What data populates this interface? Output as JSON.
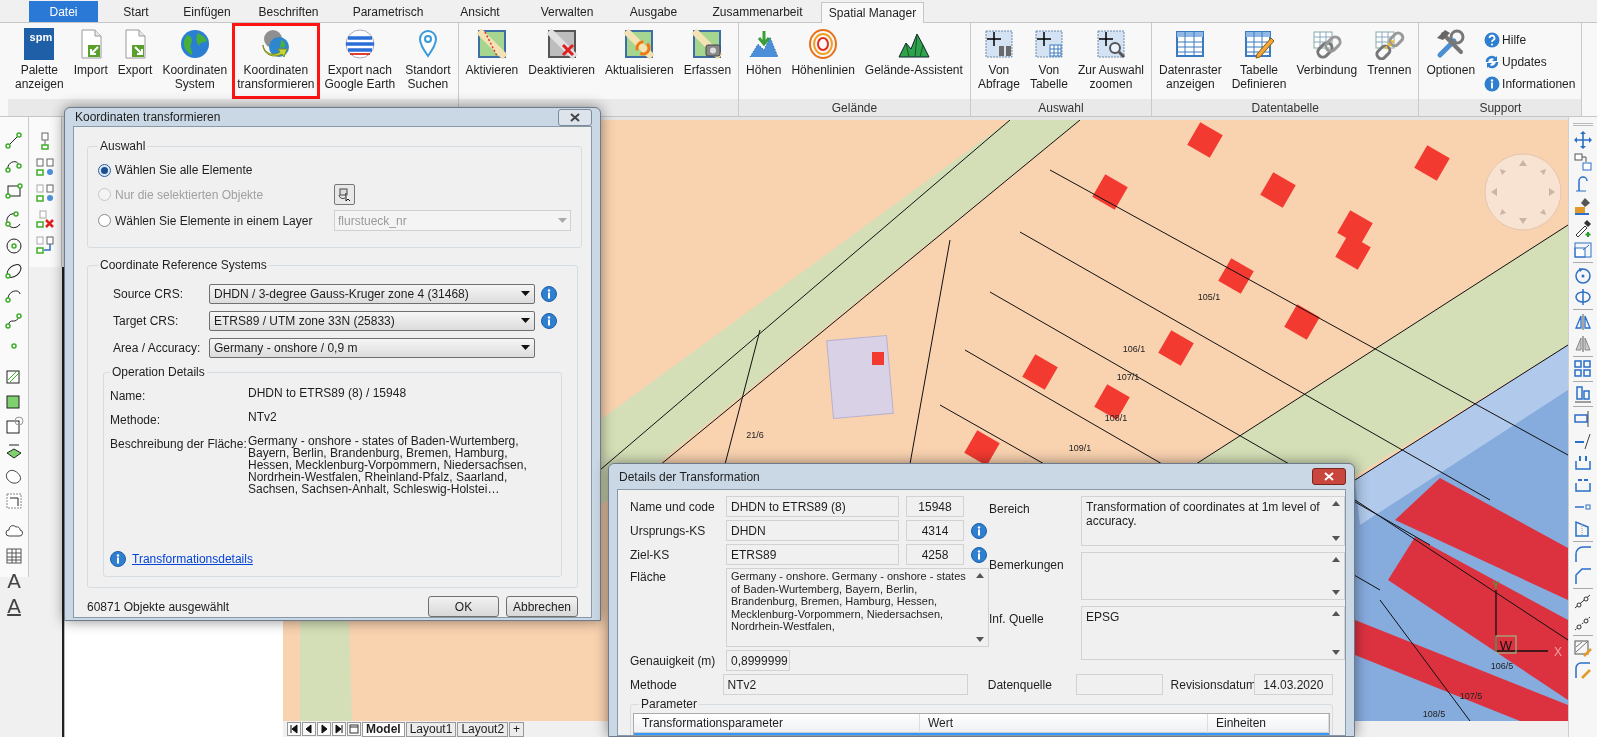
{
  "tabs": [
    {
      "label": "Datei",
      "kind": "app-menu",
      "selected": false
    },
    {
      "label": "Start",
      "kind": "tab",
      "selected": false
    },
    {
      "label": "Einfügen",
      "kind": "tab",
      "selected": false
    },
    {
      "label": "Beschriften",
      "kind": "tab",
      "selected": false
    },
    {
      "label": "Parametrisch",
      "kind": "tab",
      "selected": false
    },
    {
      "label": "Ansicht",
      "kind": "tab",
      "selected": false
    },
    {
      "label": "Verwalten",
      "kind": "tab",
      "selected": false
    },
    {
      "label": "Ausgabe",
      "kind": "tab",
      "selected": false
    },
    {
      "label": "Zusammenarbeit",
      "kind": "tab",
      "selected": false
    },
    {
      "label": "Spatial Manager",
      "kind": "tab",
      "selected": true
    }
  ],
  "ribbon": {
    "groups": [
      {
        "buttons": [
          {
            "label": "Palette\nanzeigen",
            "kind": "large",
            "highlighted": false,
            "logo": "spm"
          },
          {
            "label": "Import",
            "kind": "large",
            "highlighted": false
          },
          {
            "label": "Export",
            "kind": "large",
            "highlighted": false
          },
          {
            "label": "Koordinaten\nSystem",
            "kind": "large",
            "highlighted": false
          },
          {
            "label": "Koordinaten\ntransformieren",
            "kind": "large",
            "highlighted": true
          },
          {
            "label": "Export nach\nGoogle Earth",
            "kind": "large",
            "highlighted": false
          },
          {
            "label": "Standort\nSuchen",
            "kind": "large",
            "highlighted": false
          }
        ]
      },
      {
        "buttons": [
          {
            "label": "Aktivieren",
            "kind": "large",
            "highlighted": false
          },
          {
            "label": "Deaktivieren",
            "kind": "large",
            "highlighted": false
          },
          {
            "label": "Aktualisieren",
            "kind": "large",
            "highlighted": false
          },
          {
            "label": "Erfassen",
            "kind": "large",
            "highlighted": false
          }
        ]
      },
      {
        "label": "Gelände",
        "buttons": [
          {
            "label": "Höhen",
            "kind": "large",
            "highlighted": false
          },
          {
            "label": "Höhenlinien",
            "kind": "large",
            "highlighted": false
          },
          {
            "label": "Gelände-Assistent",
            "kind": "large",
            "highlighted": false
          }
        ]
      },
      {
        "label": "Auswahl",
        "buttons": [
          {
            "label": "Von\nAbfrage",
            "kind": "large",
            "highlighted": false
          },
          {
            "label": "Von\nTabelle",
            "kind": "large",
            "highlighted": false
          },
          {
            "label": "Zur Auswahl\nzoomen",
            "kind": "large",
            "highlighted": false
          }
        ]
      },
      {
        "label": "Datentabelle",
        "buttons": [
          {
            "label": "Datenraster\nanzeigen",
            "kind": "large",
            "highlighted": false
          },
          {
            "label": "Tabelle\nDefinieren",
            "kind": "large",
            "highlighted": false
          },
          {
            "label": "Verbindung",
            "kind": "large",
            "highlighted": false
          },
          {
            "label": "Trennen",
            "kind": "large",
            "highlighted": false
          }
        ]
      },
      {
        "label": "Support",
        "buttons": [
          {
            "label": "Optionen",
            "kind": "large",
            "highlighted": false
          },
          {
            "label": "Hilfe",
            "kind": "small",
            "highlighted": false
          },
          {
            "label": "Updates",
            "kind": "small",
            "highlighted": false
          },
          {
            "label": "Informationen",
            "kind": "small",
            "highlighted": false
          }
        ]
      }
    ]
  },
  "left_toolbar": {
    "text_tools": [
      "A",
      "A"
    ]
  },
  "map": {
    "parcel_labels": [
      "21/6",
      "105/1",
      "106/1",
      "107/1",
      "108/1",
      "109/1",
      "106/5",
      "107/5",
      "108/5"
    ],
    "ucs": {
      "y_axis": "Y",
      "origin": "W",
      "x_axis": "X"
    }
  },
  "layout_tabs": [
    {
      "label": "Model",
      "selected": true
    },
    {
      "label": "Layout1",
      "selected": false
    },
    {
      "label": "Layout2",
      "selected": false
    }
  ],
  "add_layout": "+",
  "transform_dialog": {
    "title": "Koordinaten transformieren",
    "selection": {
      "title": "Auswahl",
      "options": [
        {
          "label": "Wählen Sie alle Elemente",
          "selected": true,
          "disabled": false
        },
        {
          "label": "Nur die selektierten Objekte",
          "selected": false,
          "disabled": true
        },
        {
          "label": "Wählen Sie Elemente in einem Layer",
          "selected": false,
          "disabled": false
        }
      ],
      "layer": {
        "value": "flurstueck_nr",
        "disabled": true
      }
    },
    "crs": {
      "title": "Coordinate Reference Systems",
      "fields": [
        {
          "label": "Source CRS:",
          "value": "DHDN / 3-degree Gauss-Kruger zone 4 (31468)",
          "info": true
        },
        {
          "label": "Target CRS:",
          "value": "ETRS89 / UTM zone 33N (25833)",
          "info": true
        },
        {
          "label": "Area / Accuracy:",
          "value": "Germany - onshore / 0,9 m",
          "info": false
        }
      ]
    },
    "details": {
      "title": "Operation Details",
      "rows": [
        {
          "label": "Name:",
          "value": "DHDN to ETRS89 (8) / 15948"
        },
        {
          "label": "Methode:",
          "value": "NTv2"
        },
        {
          "label": "Beschreibung der Fläche:",
          "value": "Germany - onshore - states of Baden-Wurtemberg, Bayern, Berlin, Brandenburg, Bremen, Hamburg, Hessen, Mecklenburg-Vorpommern, Niedersachsen, Nordrhein-Westfalen, Rheinland-Pfalz, Saarland, Sachsen, Sachsen-Anhalt, Schleswig-Holstei…"
        }
      ],
      "link": "Transformationsdetails"
    },
    "status": "60871 Objekte ausgewählt",
    "buttons": [
      "OK",
      "Abbrechen"
    ]
  },
  "details_dialog": {
    "title": "Details der Transformation",
    "codes": [
      {
        "label": "Name und code",
        "value": "DHDN to ETRS89 (8)",
        "code": "15948",
        "info": false
      },
      {
        "label": "Ursprungs-KS",
        "value": "DHDN",
        "code": "4314",
        "info": true
      },
      {
        "label": "Ziel-KS",
        "value": "ETRS89",
        "code": "4258",
        "info": true
      }
    ],
    "area": {
      "label": "Fläche",
      "value": "Germany - onshore. Germany - onshore - states of Baden-Wurtemberg, Bayern, Berlin, Brandenburg, Bremen, Hamburg, Hessen, Mecklenburg-Vorpommern, Niedersachsen, Nordrhein-Westfalen,"
    },
    "accuracy": {
      "label": "Genauigkeit (m)",
      "value": "0,8999999"
    },
    "notes": [
      {
        "label": "Bereich",
        "value": "Transformation of coordinates at 1m level of accuracy."
      },
      {
        "label": "Bemerkungen"
      },
      {
        "label": "Inf. Quelle",
        "value": "EPSG"
      }
    ],
    "method": {
      "label": "Methode",
      "value": "NTv2"
    },
    "source": {
      "label": "Datenquelle"
    },
    "revision": {
      "label": "Revisionsdatum",
      "value": "14.03.2020"
    },
    "parameters": {
      "title": "Parameter",
      "columns": [
        "Transformationsparameter",
        "Wert",
        "Einheiten"
      ],
      "rows": [
        {
          "selected": true
        }
      ]
    }
  }
}
